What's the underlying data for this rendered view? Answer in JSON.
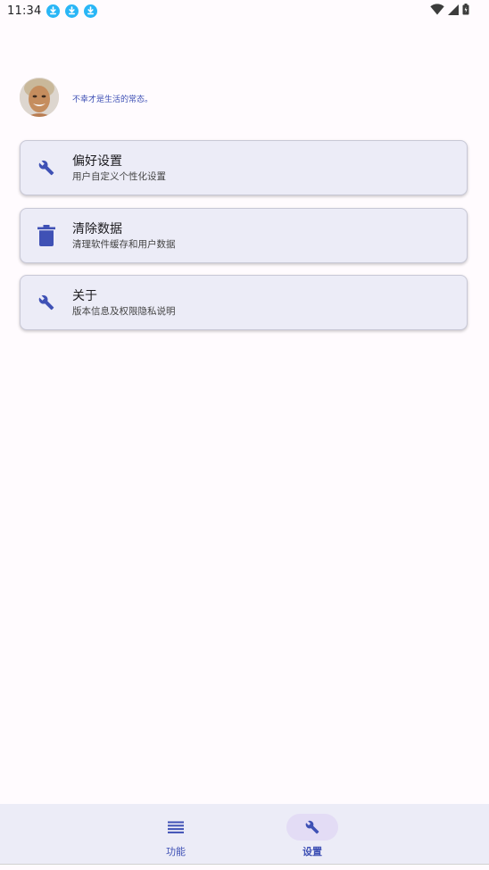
{
  "status_bar": {
    "time": "11:34",
    "notification_icons": [
      "download-icon",
      "download-icon",
      "download-icon"
    ],
    "right_icons": [
      "wifi-icon",
      "signal-icon",
      "battery-icon"
    ]
  },
  "profile": {
    "motto": "不幸才是生活的常态。"
  },
  "cards": [
    {
      "title": "偏好设置",
      "subtitle": "用户自定义个性化设置",
      "icon": "wrench-icon"
    },
    {
      "title": "清除数据",
      "subtitle": "清理软件缓存和用户数据",
      "icon": "trash-icon"
    },
    {
      "title": "关于",
      "subtitle": "版本信息及权限隐私说明",
      "icon": "wrench-icon"
    }
  ],
  "bottom_nav": {
    "items": [
      {
        "label": "功能",
        "icon": "menu-icon",
        "active": false
      },
      {
        "label": "设置",
        "icon": "wrench-icon",
        "active": true
      }
    ]
  },
  "colors": {
    "accent": "#3f51b5",
    "background": "#fffbfe",
    "card_bg": "#ececf7",
    "nav_indicator": "#e3dcf5",
    "download_badge": "#29b6f6"
  }
}
